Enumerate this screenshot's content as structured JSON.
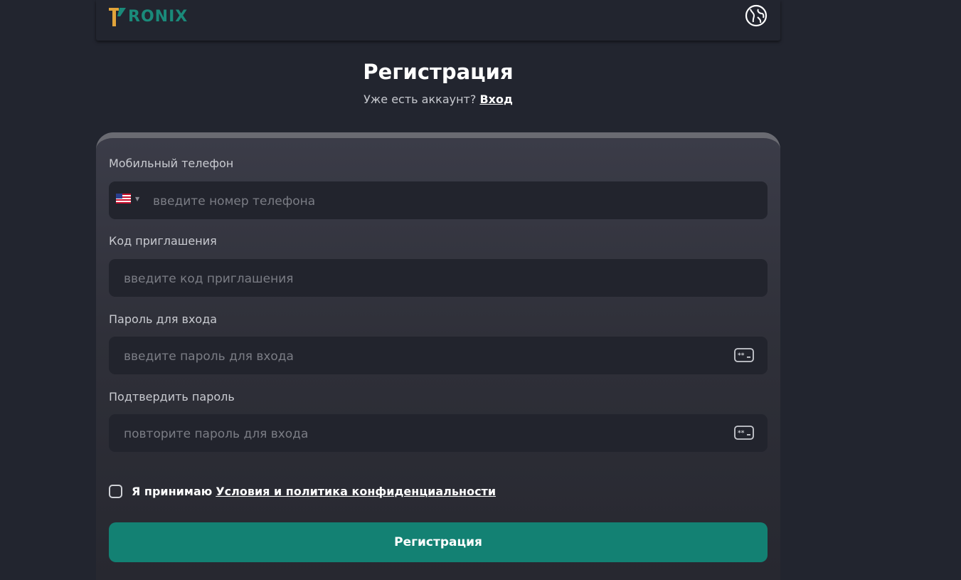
{
  "header": {
    "logo_lead": "T",
    "logo_ron": "RON",
    "logo_ix": "IX",
    "language_icon": "globe-icon"
  },
  "page": {
    "title": "Регистрация",
    "subtitle_prefix": "Уже есть аккаунт?",
    "login_link": "Вход"
  },
  "form": {
    "phone": {
      "label": "Мобильный телефон",
      "placeholder": "введите номер телефона",
      "country_icon": "us-flag-icon"
    },
    "invite": {
      "label": "Код приглашения",
      "placeholder": "введите код приглашения"
    },
    "password": {
      "label": "Пароль для входа",
      "placeholder": "введите пароль для входа",
      "toggle_icon": "hidden-password-icon"
    },
    "confirm": {
      "label": "Подтвердить пароль",
      "placeholder": "повторите пароль для входа",
      "toggle_icon": "hidden-password-icon"
    },
    "agree_prefix": "Я принимаю",
    "agree_link": "Условия и политика конфиденциальности",
    "submit_label": "Регистрация"
  },
  "colors": {
    "background": "#22252f",
    "accent": "#138173",
    "logo_gold": "#e1a43a",
    "logo_teal": "#1a8a7a"
  }
}
